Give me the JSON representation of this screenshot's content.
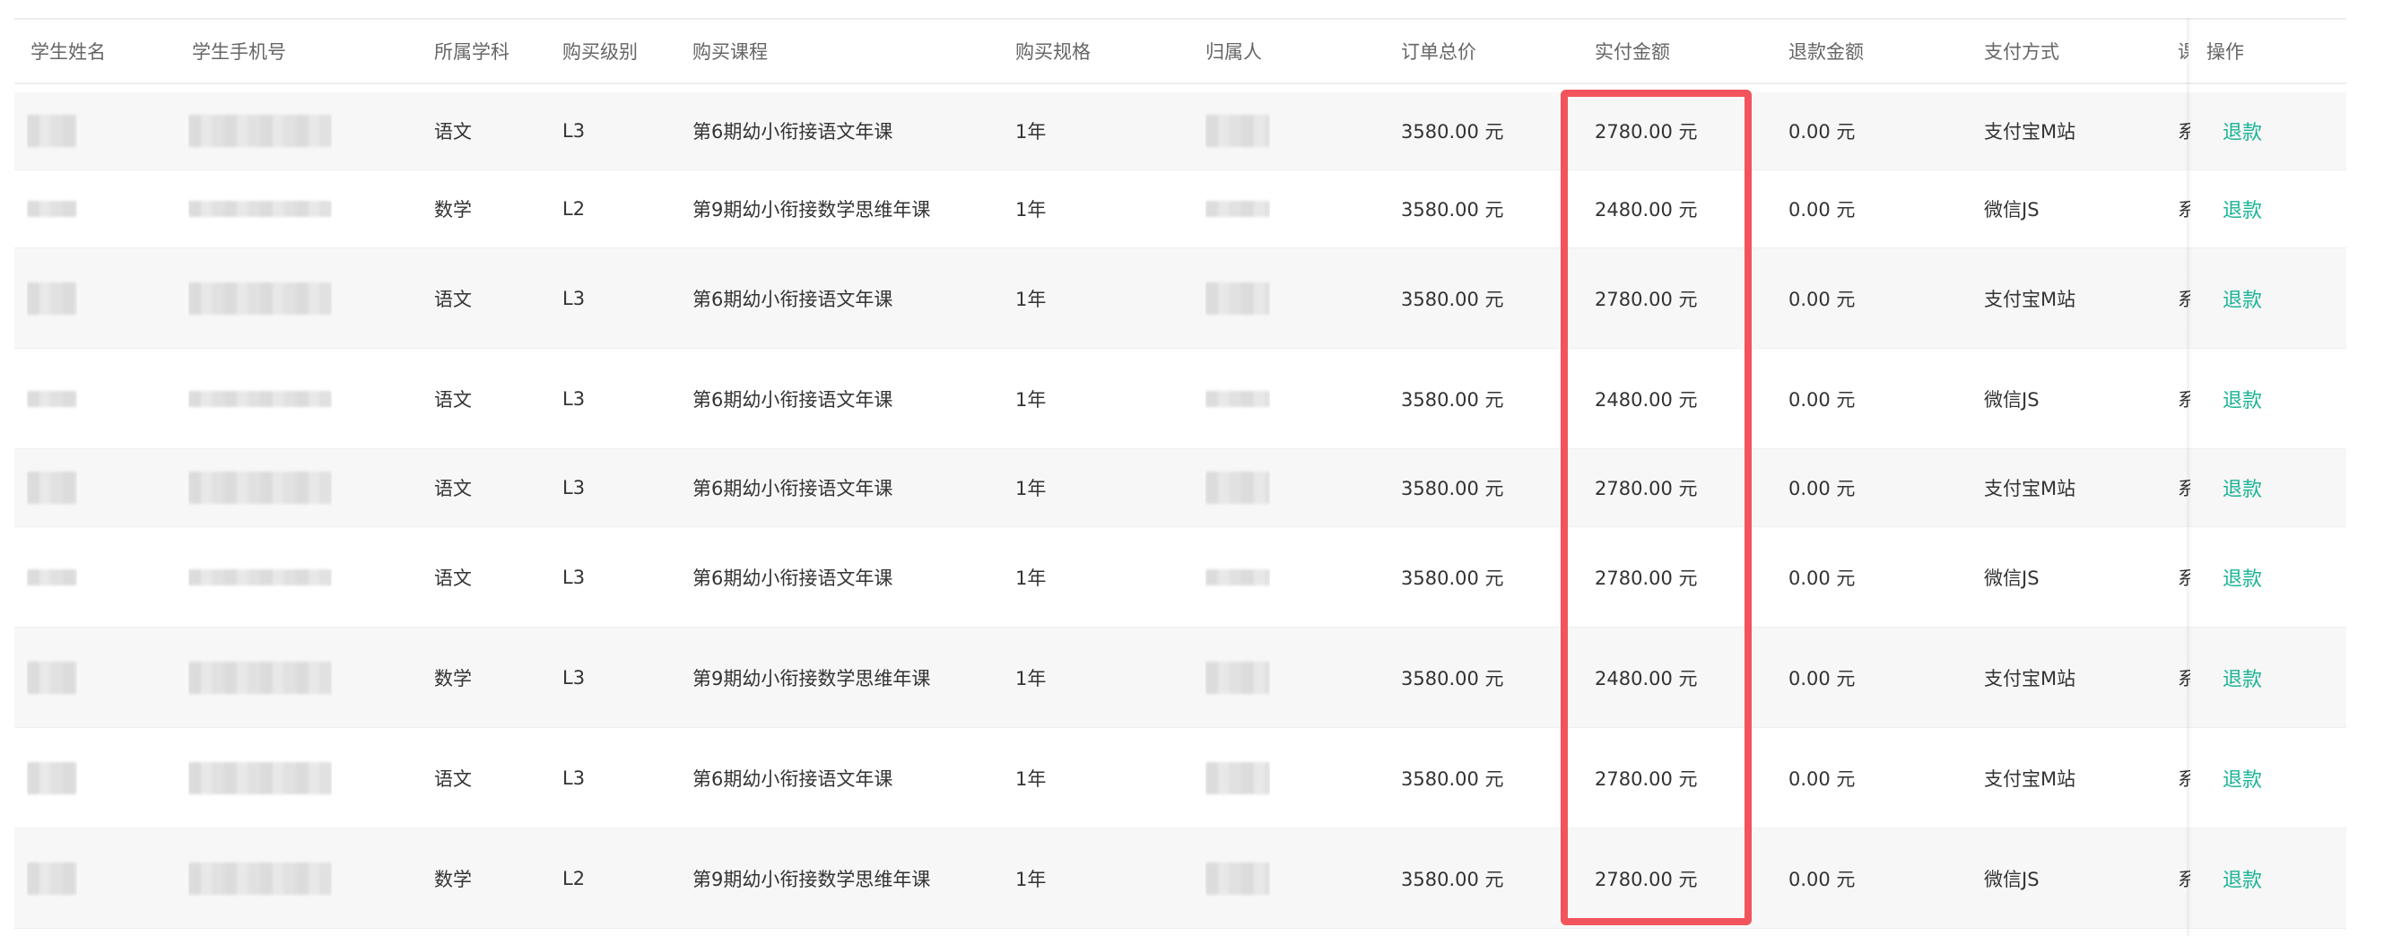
{
  "table": {
    "columns": [
      "学生姓名",
      "学生手机号",
      "所属学科",
      "购买级别",
      "购买课程",
      "购买规格",
      "归属人",
      "订单总价",
      "实付金额",
      "退款金额",
      "支付方式",
      "课",
      "操作"
    ],
    "rows": [
      {
        "subject": "语文",
        "level": "L3",
        "course": "第6期幼小衔接语文年课",
        "spec": "1年",
        "total": "3580.00 元",
        "paid": "2780.00 元",
        "refund": "0.00 元",
        "pay_method": "支付宝M站",
        "clipped": "系",
        "action": "退款"
      },
      {
        "subject": "数学",
        "level": "L2",
        "course": "第9期幼小衔接数学思维年课",
        "spec": "1年",
        "total": "3580.00 元",
        "paid": "2480.00 元",
        "refund": "0.00 元",
        "pay_method": "微信JS",
        "clipped": "系",
        "action": "退款"
      },
      {
        "subject": "语文",
        "level": "L3",
        "course": "第6期幼小衔接语文年课",
        "spec": "1年",
        "total": "3580.00 元",
        "paid": "2780.00 元",
        "refund": "0.00 元",
        "pay_method": "支付宝M站",
        "clipped": "系",
        "action": "退款"
      },
      {
        "subject": "语文",
        "level": "L3",
        "course": "第6期幼小衔接语文年课",
        "spec": "1年",
        "total": "3580.00 元",
        "paid": "2480.00 元",
        "refund": "0.00 元",
        "pay_method": "微信JS",
        "clipped": "系",
        "action": "退款"
      },
      {
        "subject": "语文",
        "level": "L3",
        "course": "第6期幼小衔接语文年课",
        "spec": "1年",
        "total": "3580.00 元",
        "paid": "2780.00 元",
        "refund": "0.00 元",
        "pay_method": "支付宝M站",
        "clipped": "系",
        "action": "退款"
      },
      {
        "subject": "语文",
        "level": "L3",
        "course": "第6期幼小衔接语文年课",
        "spec": "1年",
        "total": "3580.00 元",
        "paid": "2780.00 元",
        "refund": "0.00 元",
        "pay_method": "微信JS",
        "clipped": "系",
        "action": "退款"
      },
      {
        "subject": "数学",
        "level": "L3",
        "course": "第9期幼小衔接数学思维年课",
        "spec": "1年",
        "total": "3580.00 元",
        "paid": "2480.00 元",
        "refund": "0.00 元",
        "pay_method": "支付宝M站",
        "clipped": "系",
        "action": "退款"
      },
      {
        "subject": "语文",
        "level": "L3",
        "course": "第6期幼小衔接语文年课",
        "spec": "1年",
        "total": "3580.00 元",
        "paid": "2780.00 元",
        "refund": "0.00 元",
        "pay_method": "支付宝M站",
        "clipped": "系",
        "action": "退款"
      },
      {
        "subject": "数学",
        "level": "L2",
        "course": "第9期幼小衔接数学思维年课",
        "spec": "1年",
        "total": "3580.00 元",
        "paid": "2780.00 元",
        "refund": "0.00 元",
        "pay_method": "微信JS",
        "clipped": "系",
        "action": "退款"
      }
    ]
  },
  "colors": {
    "link": "#1ab394",
    "highlight": "#f2545b",
    "stripe": "#f7f7f7"
  }
}
